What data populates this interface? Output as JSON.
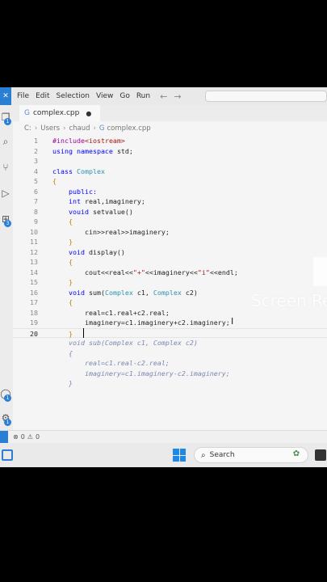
{
  "menu": {
    "items": [
      "File",
      "Edit",
      "Selection",
      "View",
      "Go",
      "Run"
    ],
    "back_arrow": "←",
    "forward_arrow": "→"
  },
  "activity_badges": [
    "1",
    "3",
    "1",
    "1"
  ],
  "tab": {
    "label": "complex.cpp",
    "modified_dot": "●"
  },
  "breadcrumb": [
    "C:",
    "Users",
    "chaud",
    "complex.cpp"
  ],
  "editor": {
    "lines": [
      {
        "n": "1",
        "parts": [
          [
            "pp",
            "#include"
          ],
          [
            "str",
            "<iostream>"
          ]
        ]
      },
      {
        "n": "2",
        "parts": [
          [
            "kw",
            "using namespace "
          ],
          [
            "",
            "std;"
          ]
        ]
      },
      {
        "n": "3",
        "parts": []
      },
      {
        "n": "4",
        "parts": [
          [
            "kw",
            "class "
          ],
          [
            "ty",
            "Complex"
          ]
        ]
      },
      {
        "n": "5",
        "parts": [
          [
            "br",
            "{"
          ]
        ]
      },
      {
        "n": "6",
        "parts": [
          [
            "",
            "    "
          ],
          [
            "kw",
            "public:"
          ]
        ]
      },
      {
        "n": "7",
        "parts": [
          [
            "",
            "    "
          ],
          [
            "kw",
            "int "
          ],
          [
            "",
            "real,imaginery;"
          ]
        ]
      },
      {
        "n": "8",
        "parts": [
          [
            "",
            "    "
          ],
          [
            "kw",
            "vouid "
          ],
          [
            "",
            "setvalue()"
          ]
        ]
      },
      {
        "n": "9",
        "parts": [
          [
            "",
            "    "
          ],
          [
            "br",
            "{"
          ]
        ]
      },
      {
        "n": "10",
        "parts": [
          [
            "",
            "        cin>>real>>imaginery;"
          ]
        ]
      },
      {
        "n": "11",
        "parts": [
          [
            "",
            "    "
          ],
          [
            "br",
            "}"
          ]
        ]
      },
      {
        "n": "12",
        "parts": [
          [
            "",
            "    "
          ],
          [
            "kw",
            "void "
          ],
          [
            "",
            "display()"
          ]
        ]
      },
      {
        "n": "13",
        "parts": [
          [
            "",
            "    "
          ],
          [
            "br",
            "{"
          ]
        ]
      },
      {
        "n": "14",
        "parts": [
          [
            "",
            "        cout<<real<<"
          ],
          [
            "str",
            "\"+\""
          ],
          [
            "",
            "<<imaginery<<"
          ],
          [
            "str",
            "\"i\""
          ],
          [
            "",
            "<<endl;"
          ]
        ]
      },
      {
        "n": "15",
        "parts": [
          [
            "",
            "    "
          ],
          [
            "br",
            "}"
          ]
        ]
      },
      {
        "n": "16",
        "parts": [
          [
            "",
            "    "
          ],
          [
            "kw",
            "void "
          ],
          [
            "",
            "sum("
          ],
          [
            "ty",
            "Complex "
          ],
          [
            "",
            "c1, "
          ],
          [
            "ty",
            "Complex "
          ],
          [
            "",
            "c2)"
          ]
        ]
      },
      {
        "n": "17",
        "parts": [
          [
            "",
            "    "
          ],
          [
            "br",
            "{"
          ]
        ]
      },
      {
        "n": "18",
        "parts": [
          [
            "",
            "        real=c1.real+c2.real;"
          ]
        ]
      },
      {
        "n": "19",
        "parts": [
          [
            "",
            "        imaginery=c1.imaginery+c2.imaginery;"
          ]
        ]
      },
      {
        "n": "20",
        "parts": [
          [
            "",
            "    "
          ],
          [
            "br",
            "}"
          ]
        ]
      }
    ],
    "ghost_lines": [
      "    void sub(Complex c1, Complex c2)",
      "    {",
      "        real=c1.real-c2.real;",
      "        imaginery=c1.imaginery-c2.imaginery;",
      "    }"
    ]
  },
  "watermark": "Screen Re",
  "status": {
    "errors": "0",
    "warnings": "0"
  },
  "taskbar": {
    "search_label": "Search"
  },
  "colors": {
    "accent": "#2a7fd4",
    "keyword": "#0000ff",
    "type": "#2b91af",
    "string": "#a31515",
    "preprocessor": "#a000a0"
  }
}
